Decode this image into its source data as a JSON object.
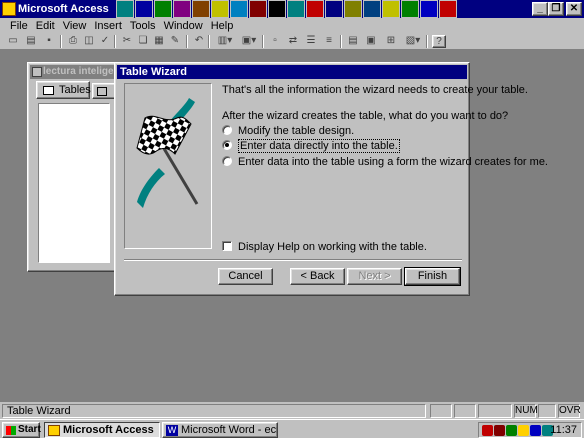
{
  "app": {
    "title": "Microsoft Access"
  },
  "menu": {
    "items": [
      "File",
      "Edit",
      "View",
      "Insert",
      "Tools",
      "Window",
      "Help"
    ]
  },
  "database_window": {
    "title": "lectura inteligenta",
    "tabs": [
      "Tables"
    ]
  },
  "wizard": {
    "title": "Table Wizard",
    "intro": "That's all the information the wizard needs to create your table.",
    "question": "After the wizard creates the table, what do you want to do?",
    "options": [
      {
        "label": "Modify the table design.",
        "checked": false
      },
      {
        "label": "Enter data directly into the table.",
        "checked": true
      },
      {
        "label": "Enter data into the table using a form the wizard creates for me.",
        "checked": false
      }
    ],
    "help_checkbox": {
      "label": "Display Help on working with the table.",
      "checked": false
    },
    "buttons": {
      "cancel": "Cancel",
      "back": "< Back",
      "next": "Next >",
      "finish": "Finish"
    }
  },
  "statusbar": {
    "text": "Table Wizard",
    "num": "NUM",
    "ovr": "OVR"
  },
  "taskbar": {
    "start": "Start",
    "tasks": [
      {
        "label": "Microsoft Access",
        "active": true
      },
      {
        "label": "Microsoft Word - ecrane a...",
        "active": false
      }
    ],
    "clock": "11:37"
  },
  "colors": {
    "titlebar": "#000080",
    "face": "#c0c0c0",
    "desktop": "#808080",
    "flag_teal": "#008080"
  }
}
